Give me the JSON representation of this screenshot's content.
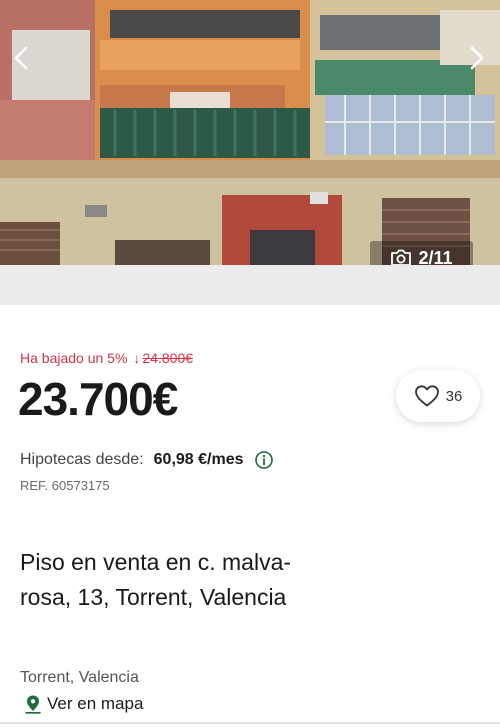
{
  "gallery": {
    "counter": "2/11",
    "icons": {
      "prev": "chevron-left-icon",
      "next": "chevron-right-icon",
      "camera": "camera-icon"
    }
  },
  "listing": {
    "price_drop_label": "Ha bajado un 5%",
    "old_price": "24.800€",
    "price": "23.700€",
    "favorites_count": "36",
    "mortgage_label": "Hipotecas desde:",
    "mortgage_value": "60,98 €/mes",
    "reference": "REF. 60573175",
    "title": "Piso en venta en c. malva-rosa, 13, Torrent, Valencia",
    "location": "Torrent, Valencia",
    "map_link": "Ver en mapa"
  },
  "colors": {
    "accent_red": "#d0344b",
    "map_icon_green": "#1f6b3c",
    "text": "#1a1a1a"
  }
}
